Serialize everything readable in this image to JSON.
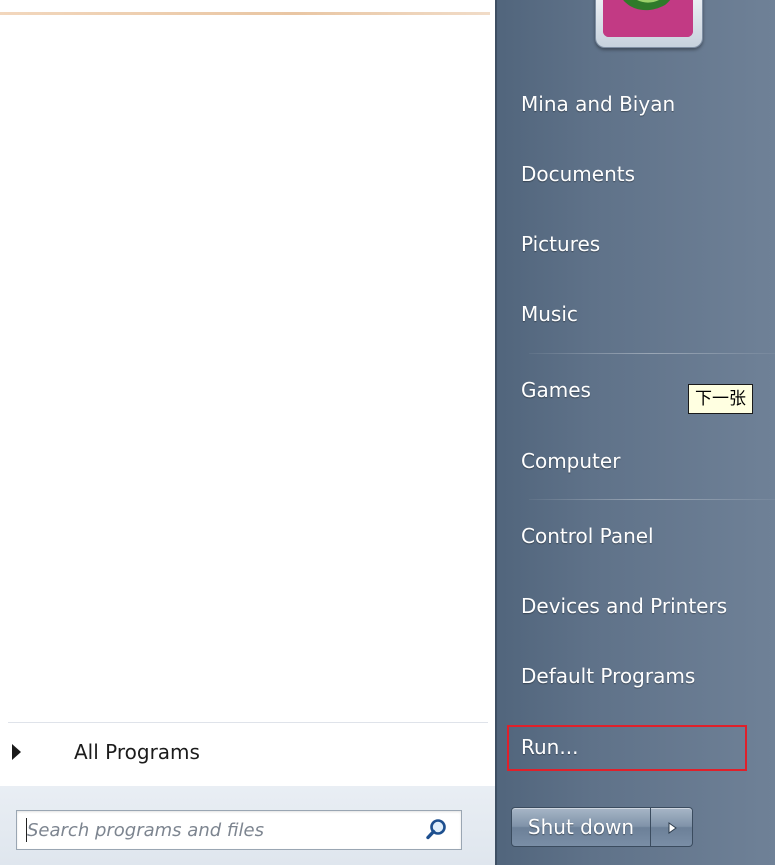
{
  "start_menu": {
    "left": {
      "all_programs_label": "All Programs",
      "search": {
        "placeholder": "Search programs and files",
        "value": ""
      }
    },
    "right": {
      "items": [
        {
          "label": "Mina and Biyan"
        },
        {
          "label": "Documents"
        },
        {
          "label": "Pictures"
        },
        {
          "label": "Music"
        },
        {
          "label": "Games"
        },
        {
          "label": "Computer"
        },
        {
          "label": "Control Panel"
        },
        {
          "label": "Devices and Printers"
        },
        {
          "label": "Default Programs"
        },
        {
          "label": "Run..."
        }
      ],
      "shutdown_label": "Shut down"
    },
    "tooltip": "下一张",
    "colors": {
      "right_pane": "#5f7289",
      "highlight": "#e0202a",
      "tooltip_bg": "#ffffe1",
      "avatar_pink": "#c23a84"
    },
    "icons": [
      "search-icon",
      "avatar-icon",
      "expand-arrow-icon",
      "shutdown-options-arrow-icon"
    ]
  }
}
